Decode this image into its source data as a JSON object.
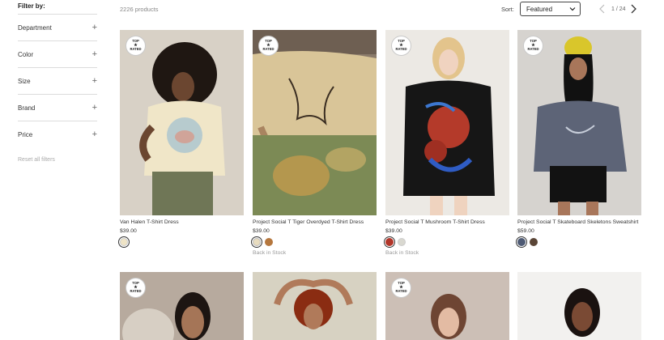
{
  "sidebar": {
    "title": "Filter by:",
    "filters": [
      {
        "label": "Department"
      },
      {
        "label": "Color"
      },
      {
        "label": "Size"
      },
      {
        "label": "Brand"
      },
      {
        "label": "Price"
      }
    ],
    "reset_label": "Reset all filters"
  },
  "toolbar": {
    "count": "2226 products",
    "sort_label": "Sort:",
    "sort_value": "Featured",
    "page": "1",
    "page_sep": "/",
    "page_total": "24"
  },
  "badge": {
    "line1": "TOP",
    "star": "★",
    "line2": "RATED"
  },
  "products": [
    {
      "name": "Van Halen T-Shirt Dress",
      "price": "$39.00",
      "swatches": [
        "#efe4c6"
      ],
      "stock": ""
    },
    {
      "name": "Project Social T Tiger Overdyed T-Shirt Dress",
      "price": "$39.00",
      "swatches": [
        "#e8dcbf",
        "#b5773e"
      ],
      "stock": "Back in Stock"
    },
    {
      "name": "Project Social T Mushroom T-Shirt Dress",
      "price": "$39.00",
      "swatches": [
        "#b2362a",
        "#d9d8d0"
      ],
      "stock": "Back in Stock"
    },
    {
      "name": "Project Social T Skateboard Skeletons Sweatshirt",
      "price": "$59.00",
      "swatches": [
        "#4e5a74",
        "#5a4536"
      ],
      "stock": ""
    }
  ],
  "colors": {
    "accent": "#333333",
    "muted": "#999999",
    "divider": "#dcdcdc"
  }
}
